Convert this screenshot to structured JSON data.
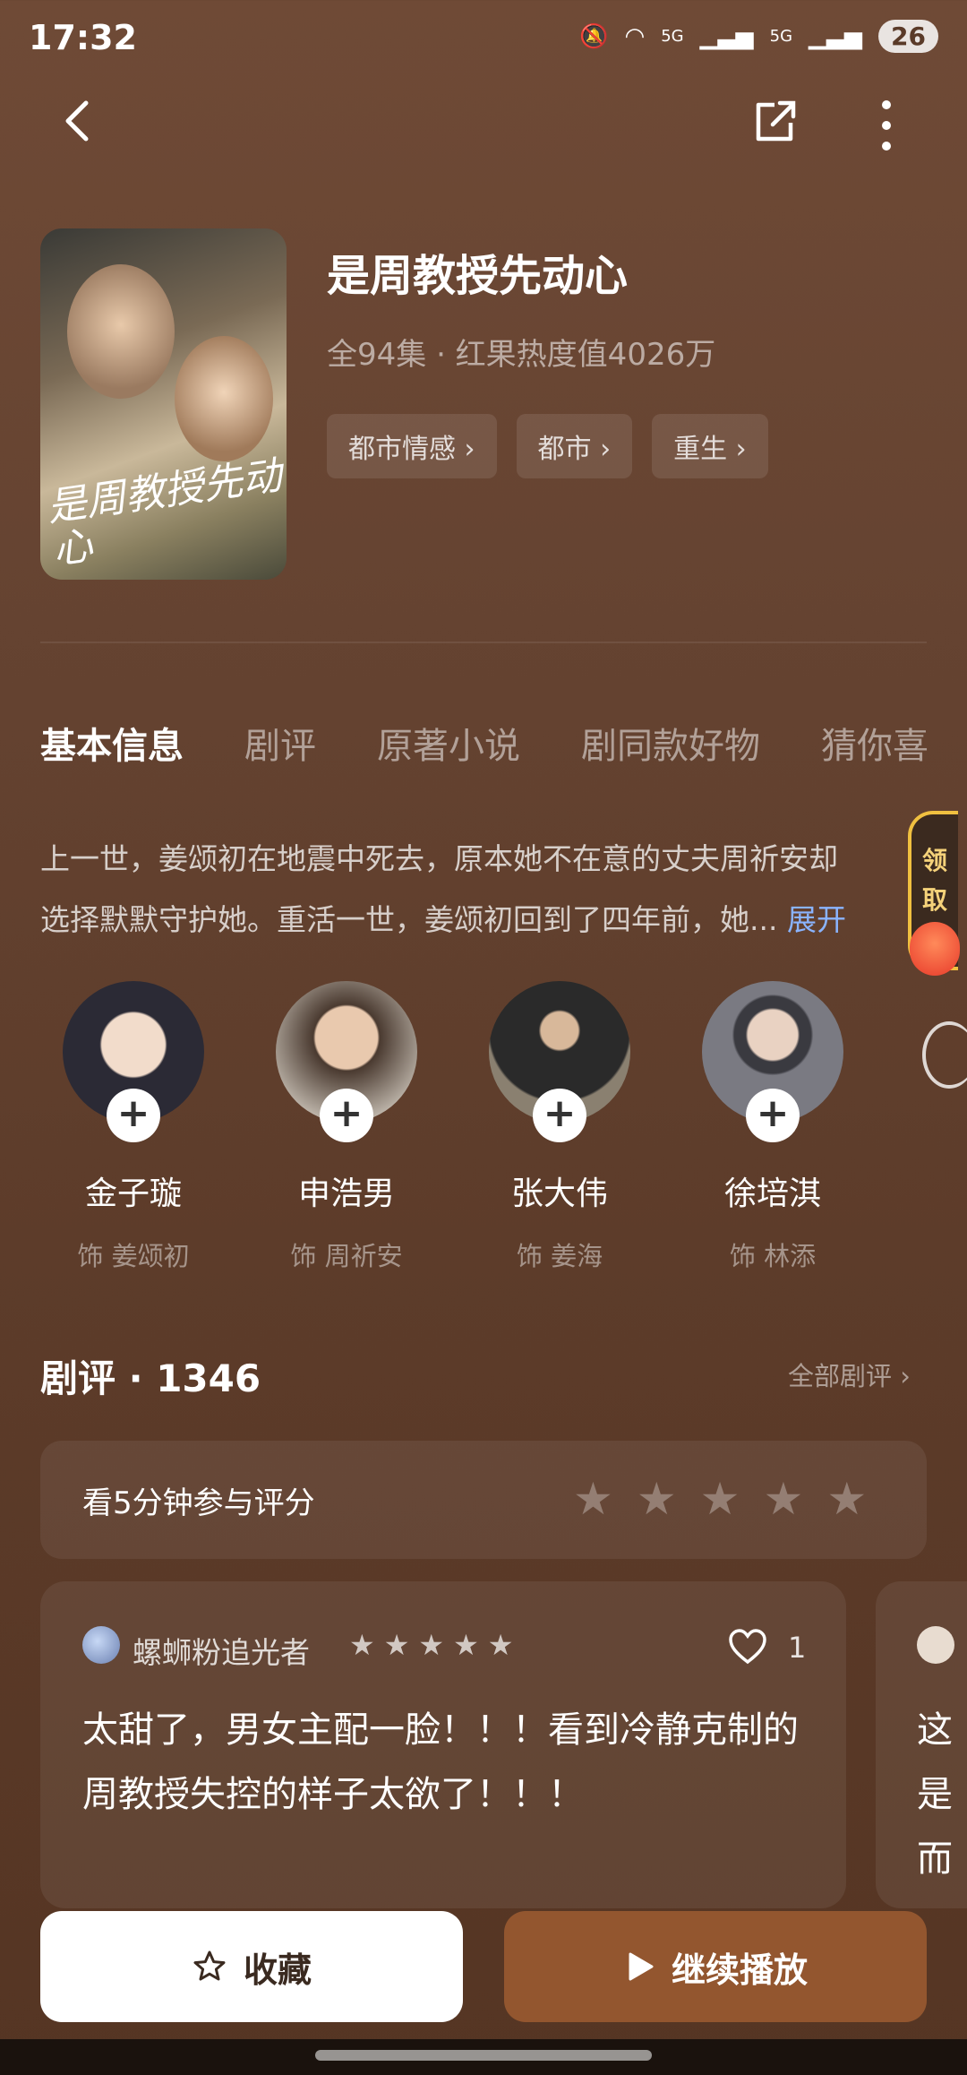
{
  "status": {
    "time": "17:32",
    "battery": "26",
    "net1": "5G",
    "net2": "5G"
  },
  "show": {
    "title": "是周教授先动心",
    "subtitle": "全94集 · 红果热度值4026万",
    "tags": [
      "都市情感",
      "都市",
      "重生"
    ],
    "poster_text": "是周教授先动心"
  },
  "tabs": [
    "基本信息",
    "剧评",
    "原著小说",
    "剧同款好物",
    "猜你喜"
  ],
  "description": {
    "line1": "上一世，姜颂初在地震中死去，原本她不在意的丈夫周祈安却",
    "line2": "选择默默守护她。重活一世，姜颂初回到了四年前，她...",
    "expand": "展开"
  },
  "reward": {
    "label1": "领",
    "label2": "取"
  },
  "cast": [
    {
      "name": "金子璇",
      "role": "饰 姜颂初",
      "color": "#2b2a35"
    },
    {
      "name": "申浩男",
      "role": "饰 周祈安",
      "color": "#4a3a30"
    },
    {
      "name": "张大伟",
      "role": "饰 姜海",
      "color": "#5a5045"
    },
    {
      "name": "徐培淇",
      "role": "饰 林添",
      "color": "#7a7a82"
    }
  ],
  "reviews": {
    "title": "剧评 · 1346",
    "all_link": "全部剧评 ›",
    "rate_prompt": "看5分钟参与评分",
    "item": {
      "user": "螺蛳粉追光者",
      "likes": "1",
      "text": "太甜了，男女主配一脸！！！看到冷静克制的周教授失控的样子太欲了！！！"
    },
    "peek_text": "这\n是\n而"
  },
  "buttons": {
    "favorite": "收藏",
    "play": "继续播放"
  }
}
